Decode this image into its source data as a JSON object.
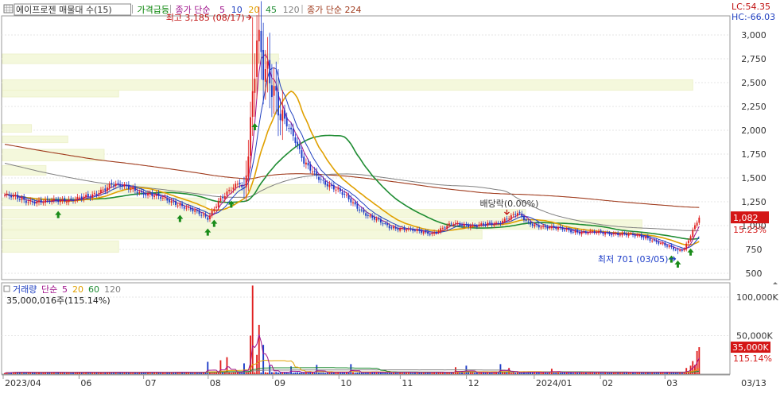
{
  "price_panel": {
    "legend": [
      {
        "label": "에이프로젠 매물대 수(15)",
        "color": "#333333"
      },
      {
        "label": "가격급등",
        "color": "#008000"
      },
      {
        "label": "종가 단순",
        "color": "#a0148c"
      },
      {
        "label": "5",
        "color": "#a0148c"
      },
      {
        "label": "10",
        "color": "#2040c0"
      },
      {
        "label": "20",
        "color": "#e0a000"
      },
      {
        "label": "45",
        "color": "#1e8c32"
      },
      {
        "label": "120",
        "color": "#808080"
      },
      {
        "label": "종가 단순 224",
        "color": "#a03c1e"
      }
    ],
    "lc_label": "LC:54.35",
    "hc_label": "HC:-66.03",
    "current_price_tag": "1,082",
    "change_tag": "15.23%",
    "high_annotation": "최고 3,185 (08/17)",
    "low_annotation": "최저 701 (03/05)",
    "dividend_annotation": "배당락(0.00%)"
  },
  "volume_panel": {
    "legend": [
      {
        "label": "거래량",
        "color": "#2040c0"
      },
      {
        "label": "단순",
        "color": "#a0148c"
      },
      {
        "label": "5",
        "color": "#a0148c"
      },
      {
        "label": "20",
        "color": "#e0a000"
      },
      {
        "label": "60",
        "color": "#1e8c32"
      },
      {
        "label": "120",
        "color": "#808080"
      }
    ],
    "volume_info": "35,000,016주(115.14%)",
    "current_volume_tag": "35,000K",
    "change_tag": "115.14%"
  },
  "colors": {
    "up": "#e02020",
    "down": "#1c3cc8",
    "ma5": "#a0148c",
    "ma10": "#2040c0",
    "ma20": "#e0a000",
    "ma45": "#1e8c32",
    "ma120": "#808080",
    "ma224": "#a03c1e",
    "band": "#f4f8dc"
  },
  "chart_data": [
    {
      "type": "candlestick",
      "title": "에이프로젠 매물대 수(15)",
      "ylim": [
        500,
        3300
      ],
      "yticks": [
        500,
        750,
        1000,
        1250,
        1500,
        1750,
        2000,
        2250,
        2500,
        2750,
        3000
      ],
      "ytick_labels": [
        "500",
        "750",
        "1,000",
        "1,250",
        "1,500",
        "1,750",
        "2,000",
        "2,250",
        "2,500",
        "2,750",
        "3,000"
      ],
      "x_labels": [
        "2023/04",
        "06",
        "07",
        "08",
        "09",
        "10",
        "11",
        "12",
        "2024/01",
        "02",
        "03",
        "03/13"
      ],
      "close_path": [
        [
          0,
          1320
        ],
        [
          10,
          1260
        ],
        [
          20,
          1250
        ],
        [
          40,
          1300
        ],
        [
          50,
          1440
        ],
        [
          60,
          1380
        ],
        [
          80,
          1240
        ],
        [
          95,
          1080
        ],
        [
          100,
          1260
        ],
        [
          110,
          1450
        ],
        [
          112,
          1350
        ],
        [
          116,
          2400
        ],
        [
          118,
          3050
        ],
        [
          121,
          2600
        ],
        [
          125,
          2400
        ],
        [
          135,
          1950
        ],
        [
          140,
          1650
        ],
        [
          150,
          1450
        ],
        [
          160,
          1300
        ],
        [
          170,
          1100
        ],
        [
          180,
          990
        ],
        [
          190,
          950
        ],
        [
          200,
          920
        ],
        [
          210,
          1020
        ],
        [
          220,
          1000
        ],
        [
          230,
          1020
        ],
        [
          235,
          1080
        ],
        [
          240,
          1130
        ],
        [
          245,
          1020
        ],
        [
          255,
          980
        ],
        [
          270,
          930
        ],
        [
          285,
          920
        ],
        [
          300,
          880
        ],
        [
          310,
          780
        ],
        [
          315,
          740
        ],
        [
          318,
          760
        ],
        [
          322,
          950
        ],
        [
          325,
          1082
        ]
      ],
      "high": {
        "value": 3185,
        "label": "최고 3,185 (08/17)"
      },
      "low": {
        "value": 701,
        "label": "최저 701 (03/05)"
      },
      "close": 1082,
      "change_pct": "15.23%",
      "moving_averages": [
        {
          "name": "종가 단순 5",
          "period": 5
        },
        {
          "name": "10",
          "period": 10
        },
        {
          "name": "20",
          "period": 20
        },
        {
          "name": "45",
          "period": 45
        },
        {
          "name": "120",
          "period": 120
        },
        {
          "name": "종가 단순 224",
          "period": 224
        }
      ],
      "volume_profile_bands": [
        {
          "from": 2700,
          "to": 2800,
          "extent": 0.38
        },
        {
          "from": 2420,
          "to": 2530,
          "extent": 0.95
        },
        {
          "from": 2350,
          "to": 2420,
          "extent": 0.16
        },
        {
          "from": 1980,
          "to": 2060,
          "extent": 0.04
        },
        {
          "from": 1870,
          "to": 1940,
          "extent": 0.09
        },
        {
          "from": 1680,
          "to": 1800,
          "extent": 0.14
        },
        {
          "from": 1530,
          "to": 1630,
          "extent": 0.06
        },
        {
          "from": 1340,
          "to": 1430,
          "extent": 0.45
        },
        {
          "from": 1210,
          "to": 1290,
          "extent": 0.28
        },
        {
          "from": 1080,
          "to": 1170,
          "extent": 0.72
        },
        {
          "from": 960,
          "to": 1060,
          "extent": 0.88
        },
        {
          "from": 860,
          "to": 950,
          "extent": 0.66
        },
        {
          "from": 720,
          "to": 840,
          "extent": 0.16
        }
      ],
      "grid": true
    },
    {
      "type": "bar",
      "title": "거래량",
      "ylim": [
        0,
        120000
      ],
      "ytick_labels": [
        "100,000K",
        "50,000K"
      ],
      "yticks": [
        100000,
        50000
      ],
      "unit": "K",
      "current": 35000,
      "change_pct": "115.14%",
      "spikes": [
        {
          "x": 95,
          "value": 16000
        },
        {
          "x": 101,
          "value": 18000
        },
        {
          "x": 104,
          "value": 22000
        },
        {
          "x": 112,
          "value": 14000
        },
        {
          "x": 115,
          "value": 50000
        },
        {
          "x": 116,
          "value": 115000
        },
        {
          "x": 118,
          "value": 25000
        },
        {
          "x": 119,
          "value": 64000
        },
        {
          "x": 121,
          "value": 38000
        },
        {
          "x": 124,
          "value": 12000
        },
        {
          "x": 134,
          "value": 10000
        },
        {
          "x": 146,
          "value": 12000
        },
        {
          "x": 162,
          "value": 13000
        },
        {
          "x": 211,
          "value": 9000
        },
        {
          "x": 216,
          "value": 11000
        },
        {
          "x": 232,
          "value": 13000
        },
        {
          "x": 236,
          "value": 8000
        },
        {
          "x": 256,
          "value": 7000
        },
        {
          "x": 319,
          "value": 8000
        },
        {
          "x": 321,
          "value": 11000
        },
        {
          "x": 322,
          "value": 17000
        },
        {
          "x": 323,
          "value": 12000
        },
        {
          "x": 324,
          "value": 30000
        },
        {
          "x": 325,
          "value": 35000
        }
      ],
      "grid": true
    }
  ]
}
